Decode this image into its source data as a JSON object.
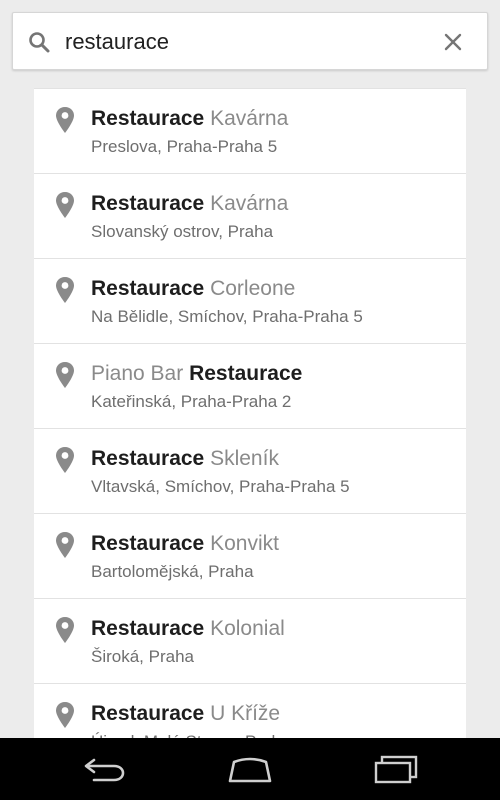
{
  "search": {
    "value": "restaurace",
    "placeholder": ""
  },
  "results": [
    {
      "bold": "Restaurace",
      "light": "Kavárna",
      "bold_first": true,
      "address": "Preslova, Praha-Praha 5"
    },
    {
      "bold": "Restaurace",
      "light": "Kavárna",
      "bold_first": true,
      "address": "Slovanský ostrov, Praha"
    },
    {
      "bold": "Restaurace",
      "light": "Corleone",
      "bold_first": true,
      "address": "Na Bělidle, Smíchov, Praha-Praha 5"
    },
    {
      "bold": "Restaurace",
      "light": "Piano Bar",
      "bold_first": false,
      "address": "Kateřinská, Praha-Praha 2"
    },
    {
      "bold": "Restaurace",
      "light": "Skleník",
      "bold_first": true,
      "address": "Vltavská, Smíchov, Praha-Praha 5"
    },
    {
      "bold": "Restaurace",
      "light": "Konvikt",
      "bold_first": true,
      "address": "Bartolomějská, Praha"
    },
    {
      "bold": "Restaurace",
      "light": "Kolonial",
      "bold_first": true,
      "address": "Široká, Praha"
    },
    {
      "bold": "Restaurace",
      "light": "U Kříže",
      "bold_first": true,
      "address": "Újezd, Malá Strana, Praha"
    }
  ],
  "icons": {
    "search": "search-icon",
    "clear": "close-icon",
    "pin": "map-pin-icon",
    "back": "back-icon",
    "home": "home-icon",
    "recents": "recents-icon"
  },
  "colors": {
    "background": "#ececec",
    "card": "#ffffff",
    "icon_gray": "#757575",
    "navbar": "#000000"
  }
}
